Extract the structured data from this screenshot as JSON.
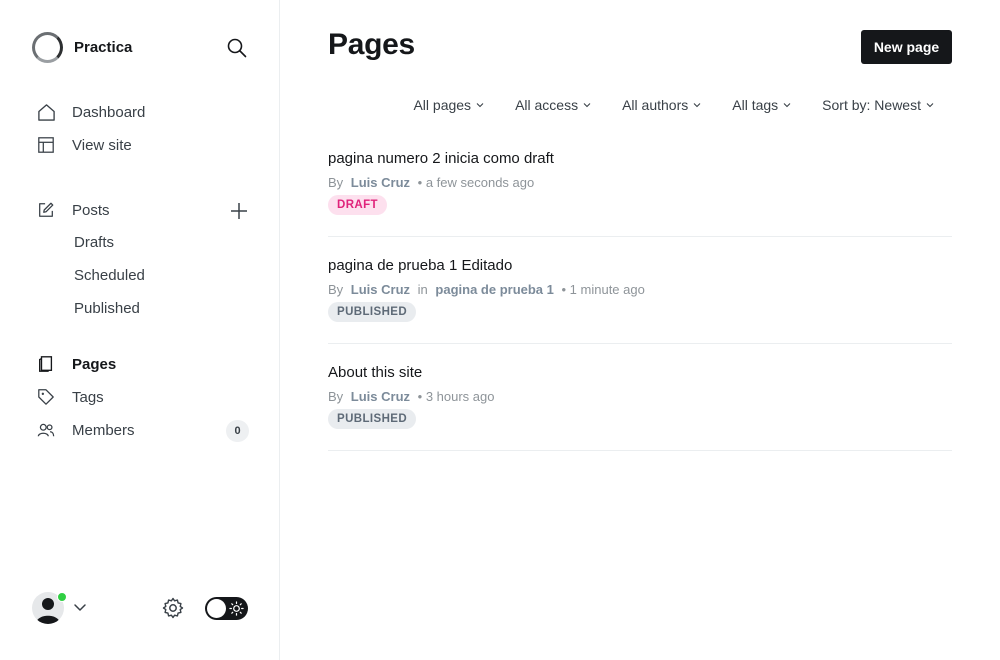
{
  "sidebar": {
    "brand_name": "Practica",
    "nav": {
      "dashboard": "Dashboard",
      "view_site": "View site",
      "posts": "Posts",
      "drafts": "Drafts",
      "scheduled": "Scheduled",
      "published": "Published",
      "pages": "Pages",
      "tags": "Tags",
      "members": "Members",
      "members_count": "0"
    }
  },
  "main": {
    "title": "Pages",
    "new_button": "New page",
    "filters": [
      "All pages",
      "All access",
      "All authors",
      "All tags",
      "Sort by: Newest"
    ],
    "items": [
      {
        "title": "pagina numero 2 inicia como draft",
        "by": "By",
        "author": "Luis Cruz",
        "in": "",
        "parent": "",
        "time": "• a few seconds ago",
        "status": "DRAFT"
      },
      {
        "title": "pagina de prueba 1 Editado",
        "by": "By",
        "author": "Luis Cruz",
        "in": "in",
        "parent": "pagina de prueba 1",
        "time": "• 1 minute ago",
        "status": "PUBLISHED"
      },
      {
        "title": "About this site",
        "by": "By",
        "author": "Luis Cruz",
        "in": "",
        "parent": "",
        "time": "• 3 hours ago",
        "status": "PUBLISHED"
      }
    ]
  },
  "colors": {
    "accent": "#15171a",
    "draft_bg": "#fde0ee",
    "draft_text": "#e0237b",
    "published_bg": "#e9ecef",
    "online": "#30cf43"
  },
  "icons": [
    "search-icon",
    "home-icon",
    "view-site-icon",
    "edit-icon",
    "plus-icon",
    "page-icon",
    "tag-icon",
    "members-icon",
    "chevron-down-icon",
    "gear-icon",
    "sun-icon",
    "user-icon"
  ]
}
